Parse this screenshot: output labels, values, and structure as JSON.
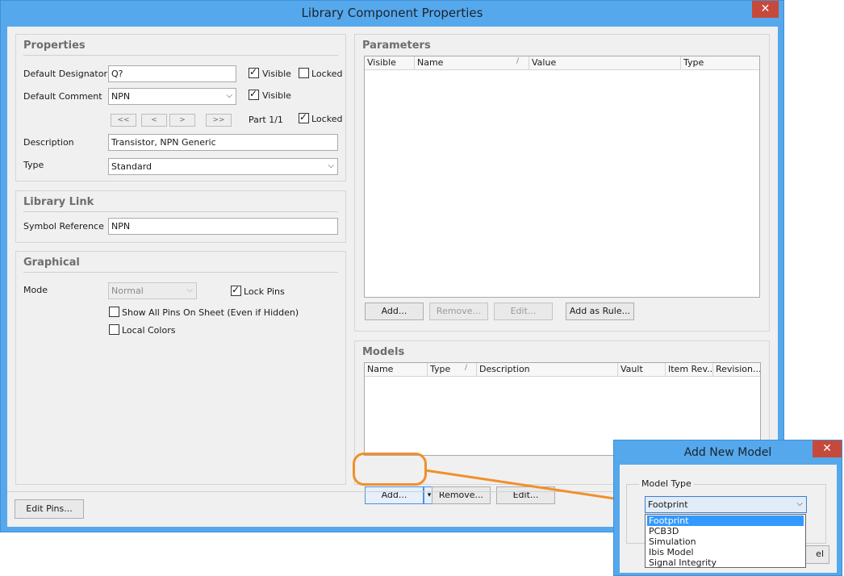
{
  "window": {
    "title": "Library Component Properties",
    "close_glyph": "✕"
  },
  "properties": {
    "title": "Properties",
    "designator_label": "Default Designator",
    "designator_value": "Q?",
    "designator_visible_label": "Visible",
    "designator_visible": true,
    "designator_locked_label": "Locked",
    "designator_locked": false,
    "comment_label": "Default Comment",
    "comment_value": "NPN",
    "comment_visible_label": "Visible",
    "comment_visible": true,
    "nav_first": "<<",
    "nav_prev": "<",
    "nav_next": ">",
    "nav_last": ">>",
    "part_label": "Part 1/1",
    "part_locked_label": "Locked",
    "part_locked": true,
    "description_label": "Description",
    "description_value": "Transistor, NPN Generic",
    "type_label": "Type",
    "type_value": "Standard"
  },
  "library_link": {
    "title": "Library Link",
    "symbol_ref_label": "Symbol Reference",
    "symbol_ref_value": "NPN"
  },
  "graphical": {
    "title": "Graphical",
    "mode_label": "Mode",
    "mode_value": "Normal",
    "lock_pins_label": "Lock Pins",
    "lock_pins": true,
    "show_hidden_pins_label": "Show All Pins On Sheet (Even if Hidden)",
    "show_hidden_pins": false,
    "local_colors_label": "Local Colors",
    "local_colors": false
  },
  "parameters": {
    "title": "Parameters",
    "columns": [
      "Visible",
      "Name",
      "Value",
      "Type"
    ],
    "sort_indicator": "/",
    "buttons": {
      "add": "Add...",
      "remove": "Remove...",
      "edit": "Edit...",
      "add_as_rule": "Add as Rule..."
    }
  },
  "models": {
    "title": "Models",
    "columns": [
      "Name",
      "Type",
      "Description",
      "Vault",
      "Item Rev...",
      "Revision..."
    ],
    "sort_indicator": "/",
    "buttons": {
      "add": "Add...",
      "remove": "Remove...",
      "edit": "Edit..."
    },
    "split_arrow": "▾"
  },
  "footer": {
    "edit_pins": "Edit Pins..."
  },
  "add_model_dialog": {
    "title": "Add New Model",
    "close_glyph": "✕",
    "model_type_label": "Model Type",
    "selected": "Footprint",
    "options": [
      "Footprint",
      "PCB3D",
      "Simulation",
      "Ibis Model",
      "Signal Integrity"
    ],
    "partial_button_text": "el"
  },
  "colors": {
    "window_frame": "#55a8eb",
    "close": "#c7493b",
    "highlight": "#3399ff",
    "annotation": "#f0902a"
  }
}
